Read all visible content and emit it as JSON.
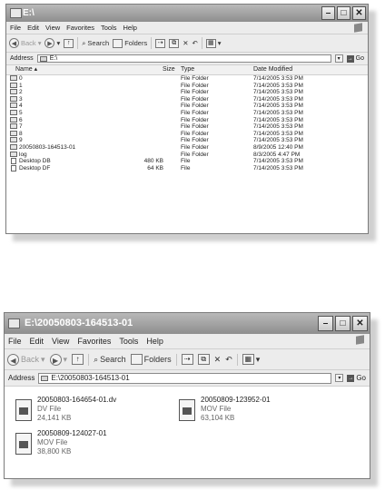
{
  "window1": {
    "title": "E:\\",
    "menu": [
      "File",
      "Edit",
      "View",
      "Favorites",
      "Tools",
      "Help"
    ],
    "toolbar": {
      "back": "Back",
      "search": "Search",
      "folders": "Folders"
    },
    "address": {
      "label": "Address",
      "value": "E:\\",
      "go": "Go"
    },
    "columns": {
      "name": "Name",
      "size": "Size",
      "type": "Type",
      "date": "Date Modified"
    },
    "rows": [
      {
        "name": "0",
        "size": "",
        "type": "File Folder",
        "date": "7/14/2005 3:53 PM"
      },
      {
        "name": "1",
        "size": "",
        "type": "File Folder",
        "date": "7/14/2005 3:53 PM"
      },
      {
        "name": "2",
        "size": "",
        "type": "File Folder",
        "date": "7/14/2005 3:53 PM"
      },
      {
        "name": "3",
        "size": "",
        "type": "File Folder",
        "date": "7/14/2005 3:53 PM"
      },
      {
        "name": "4",
        "size": "",
        "type": "File Folder",
        "date": "7/14/2005 3:53 PM"
      },
      {
        "name": "5",
        "size": "",
        "type": "File Folder",
        "date": "7/14/2005 3:53 PM"
      },
      {
        "name": "6",
        "size": "",
        "type": "File Folder",
        "date": "7/14/2005 3:53 PM"
      },
      {
        "name": "7",
        "size": "",
        "type": "File Folder",
        "date": "7/14/2005 3:53 PM"
      },
      {
        "name": "8",
        "size": "",
        "type": "File Folder",
        "date": "7/14/2005 3:53 PM"
      },
      {
        "name": "9",
        "size": "",
        "type": "File Folder",
        "date": "7/14/2005 3:53 PM"
      },
      {
        "name": "20050803-164513-01",
        "size": "",
        "type": "File Folder",
        "date": "8/9/2005 12:40 PM"
      },
      {
        "name": "log",
        "size": "",
        "type": "File Folder",
        "date": "8/3/2005 4:47 PM"
      },
      {
        "name": "Desktop DB",
        "size": "480 KB",
        "type": "File",
        "date": "7/14/2005 3:53 PM"
      },
      {
        "name": "Desktop DF",
        "size": "64 KB",
        "type": "File",
        "date": "7/14/2005 3:53 PM"
      }
    ]
  },
  "window2": {
    "title": "E:\\20050803-164513-01",
    "menu": [
      "File",
      "Edit",
      "View",
      "Favorites",
      "Tools",
      "Help"
    ],
    "toolbar": {
      "back": "Back",
      "search": "Search",
      "folders": "Folders"
    },
    "address": {
      "label": "Address",
      "value": "E:\\20050803-164513-01",
      "go": "Go"
    },
    "tiles": [
      {
        "name": "20050803-164654-01.dv",
        "type": "DV File",
        "size": "24,141 KB"
      },
      {
        "name": "20050809-123952-01",
        "type": "MOV File",
        "size": "63,104 KB"
      },
      {
        "name": "20050809-124027-01",
        "type": "MOV File",
        "size": "38,800 KB"
      }
    ]
  }
}
